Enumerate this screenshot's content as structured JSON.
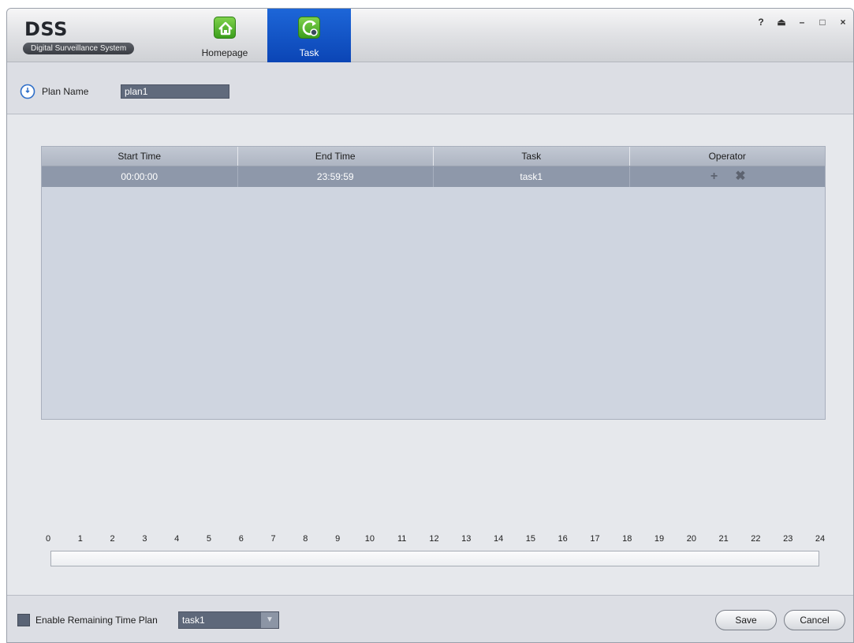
{
  "app": {
    "title": "DSS",
    "subtitle": "Digital Surveillance System",
    "nav": [
      {
        "label": "Homepage",
        "icon": "home-icon",
        "active": false
      },
      {
        "label": "Task",
        "icon": "task-gear-icon",
        "active": true
      }
    ],
    "window_controls": {
      "help": "?",
      "lock": "⏏",
      "minimize": "–",
      "maximize": "□",
      "close": "×"
    }
  },
  "plan": {
    "label": "Plan Name",
    "value": "plan1"
  },
  "table": {
    "headers": [
      "Start Time",
      "End Time",
      "Task",
      "Operator"
    ],
    "rows": [
      {
        "start": "00:00:00",
        "end": "23:59:59",
        "task": "task1"
      }
    ],
    "add_glyph": "+",
    "delete_glyph": "✖"
  },
  "timeline": {
    "hours": [
      "0",
      "1",
      "2",
      "3",
      "4",
      "5",
      "6",
      "7",
      "8",
      "9",
      "10",
      "11",
      "12",
      "13",
      "14",
      "15",
      "16",
      "17",
      "18",
      "19",
      "20",
      "21",
      "22",
      "23",
      "24"
    ]
  },
  "footer": {
    "remaining_label": "Enable Remaining Time Plan",
    "remaining_select": "task1",
    "save": "Save",
    "cancel": "Cancel"
  }
}
